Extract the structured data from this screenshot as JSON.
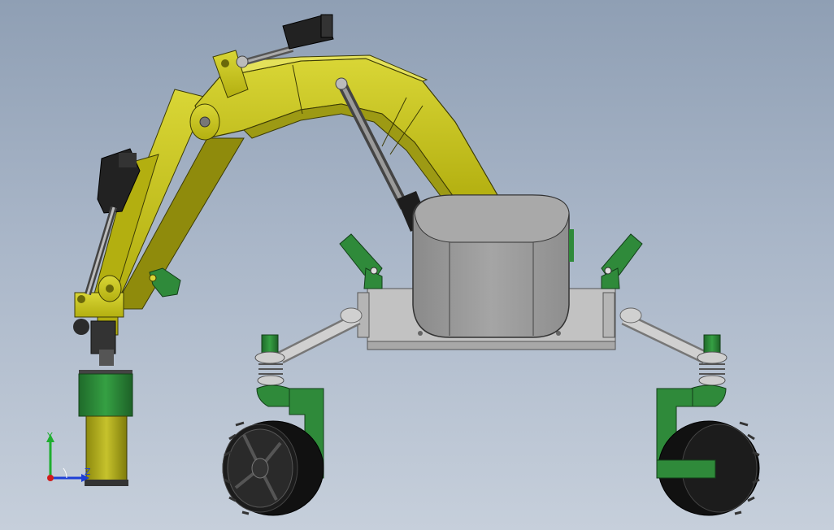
{
  "viewport": {
    "background_top": "#8f9fb4",
    "background_bottom": "#c6cfdb"
  },
  "colors": {
    "arm_yellow": "#c9c51a",
    "arm_yellow_dark": "#8f8b0c",
    "green": "#2f8a3a",
    "green_dark": "#1e5e27",
    "body_gray": "#9a9a9a",
    "frame_gray": "#c2c2c2",
    "tire_black": "#161616",
    "actuator_black": "#222222"
  },
  "triad": {
    "y_label": "Y",
    "z_label": "Z",
    "y_color": "#1fae2f",
    "z_color": "#1d3fd6",
    "x_color": "#d11b1b"
  }
}
